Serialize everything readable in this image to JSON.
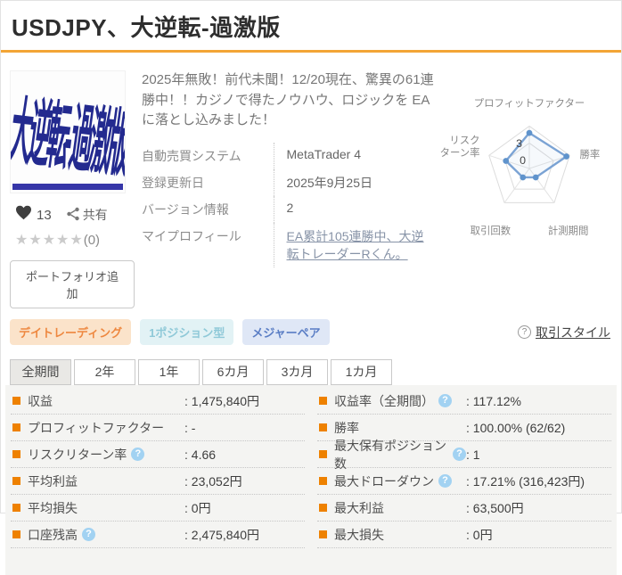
{
  "page": {
    "title": "USDJPY、大逆転-過激版"
  },
  "icons": {
    "help_glyph": "?"
  },
  "product": {
    "image_text": "大逆転-過激版",
    "likes": "13",
    "share_label": "共有",
    "rating_stars": "★★★★★",
    "rating_count": "(0)",
    "portfolio_button": "ポートフォリオ追加",
    "description": "2025年無敗！前代未聞！12/20現在、驚異の61連勝中！！カジノで得たノウハウ、ロジックを EAに落とし込みました！",
    "info": [
      {
        "label": "自動売買システム",
        "value": "MetaTrader 4"
      },
      {
        "label": "登録更新日",
        "value": "2025年9月25日"
      },
      {
        "label": "バージョン情報",
        "value": "2"
      },
      {
        "label": "マイプロフィール",
        "value": "EA累計105連勝中、大逆転トレーダーRくん。"
      }
    ]
  },
  "chart_data": {
    "type": "radar",
    "categories": [
      "プロフィットファクター",
      "勝率",
      "計測期間",
      "取引回数",
      "リスクリターン率"
    ],
    "values": [
      4.2,
      4.6,
      1.3,
      1.3,
      2.9
    ],
    "axis_labels": {
      "top": "プロフィットファクター",
      "right": "勝率",
      "bottom_right": "計測期間",
      "bottom_left": "取引回数",
      "left_line1": "リスク",
      "left_line2": "ターン率"
    },
    "scale": {
      "min": 0,
      "max": 5,
      "tick_high": "3",
      "tick_zero": "0"
    },
    "grid_rings": [
      1,
      0.6
    ],
    "legend_position": "none",
    "line_color": "#7ba3d4"
  },
  "tags": [
    "デイトレーディング",
    "1ポジション型",
    "メジャーペア"
  ],
  "trade_style_label": "取引スタイル",
  "tabs": [
    "全期間",
    "2年",
    "1年",
    "6カ月",
    "3カ月",
    "1カ月"
  ],
  "active_tab": "全期間",
  "stats": {
    "left": [
      {
        "label": "収益",
        "value": ": 1,475,840円"
      },
      {
        "label": "プロフィットファクター",
        "value": ": -"
      },
      {
        "label": "リスクリターン率",
        "value": ": 4.66",
        "help": true
      },
      {
        "label": "平均利益",
        "value": ": 23,052円"
      },
      {
        "label": "平均損失",
        "value": ": 0円"
      },
      {
        "label": "口座残高",
        "value": ": 2,475,840円",
        "help": true
      }
    ],
    "right": [
      {
        "label": "収益率（全期間）",
        "value": ": 117.12%",
        "help": true
      },
      {
        "label": "勝率",
        "value": ": 100.00% (62/62)"
      },
      {
        "label": "最大保有ポジション数",
        "value": ": 1",
        "help": true
      },
      {
        "label": "最大ドローダウン",
        "value": ": 17.21% (316,423円)",
        "help": true
      },
      {
        "label": "最大利益",
        "value": ": 63,500円"
      },
      {
        "label": "最大損失",
        "value": ": 0円"
      }
    ]
  },
  "colors": {
    "accent_orange": "#f3a536",
    "bullet_orange": "#ee8100",
    "stats_bg": "#f4f4f2",
    "radar_line": "#7ba3d4",
    "help_icon_bg": "#a2d2f2"
  }
}
